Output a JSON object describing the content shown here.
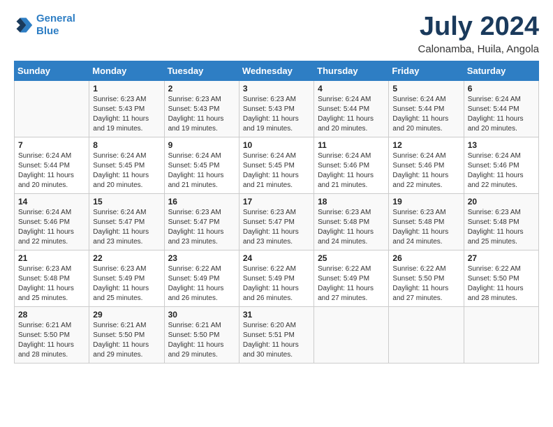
{
  "header": {
    "logo_line1": "General",
    "logo_line2": "Blue",
    "title": "July 2024",
    "location": "Calonamba, Huila, Angola"
  },
  "days_of_week": [
    "Sunday",
    "Monday",
    "Tuesday",
    "Wednesday",
    "Thursday",
    "Friday",
    "Saturday"
  ],
  "weeks": [
    [
      {
        "day": "",
        "info": ""
      },
      {
        "day": "1",
        "info": "Sunrise: 6:23 AM\nSunset: 5:43 PM\nDaylight: 11 hours\nand 19 minutes."
      },
      {
        "day": "2",
        "info": "Sunrise: 6:23 AM\nSunset: 5:43 PM\nDaylight: 11 hours\nand 19 minutes."
      },
      {
        "day": "3",
        "info": "Sunrise: 6:23 AM\nSunset: 5:43 PM\nDaylight: 11 hours\nand 19 minutes."
      },
      {
        "day": "4",
        "info": "Sunrise: 6:24 AM\nSunset: 5:44 PM\nDaylight: 11 hours\nand 20 minutes."
      },
      {
        "day": "5",
        "info": "Sunrise: 6:24 AM\nSunset: 5:44 PM\nDaylight: 11 hours\nand 20 minutes."
      },
      {
        "day": "6",
        "info": "Sunrise: 6:24 AM\nSunset: 5:44 PM\nDaylight: 11 hours\nand 20 minutes."
      }
    ],
    [
      {
        "day": "7",
        "info": "Sunrise: 6:24 AM\nSunset: 5:44 PM\nDaylight: 11 hours\nand 20 minutes."
      },
      {
        "day": "8",
        "info": "Sunrise: 6:24 AM\nSunset: 5:45 PM\nDaylight: 11 hours\nand 20 minutes."
      },
      {
        "day": "9",
        "info": "Sunrise: 6:24 AM\nSunset: 5:45 PM\nDaylight: 11 hours\nand 21 minutes."
      },
      {
        "day": "10",
        "info": "Sunrise: 6:24 AM\nSunset: 5:45 PM\nDaylight: 11 hours\nand 21 minutes."
      },
      {
        "day": "11",
        "info": "Sunrise: 6:24 AM\nSunset: 5:46 PM\nDaylight: 11 hours\nand 21 minutes."
      },
      {
        "day": "12",
        "info": "Sunrise: 6:24 AM\nSunset: 5:46 PM\nDaylight: 11 hours\nand 22 minutes."
      },
      {
        "day": "13",
        "info": "Sunrise: 6:24 AM\nSunset: 5:46 PM\nDaylight: 11 hours\nand 22 minutes."
      }
    ],
    [
      {
        "day": "14",
        "info": "Sunrise: 6:24 AM\nSunset: 5:46 PM\nDaylight: 11 hours\nand 22 minutes."
      },
      {
        "day": "15",
        "info": "Sunrise: 6:24 AM\nSunset: 5:47 PM\nDaylight: 11 hours\nand 23 minutes."
      },
      {
        "day": "16",
        "info": "Sunrise: 6:23 AM\nSunset: 5:47 PM\nDaylight: 11 hours\nand 23 minutes."
      },
      {
        "day": "17",
        "info": "Sunrise: 6:23 AM\nSunset: 5:47 PM\nDaylight: 11 hours\nand 23 minutes."
      },
      {
        "day": "18",
        "info": "Sunrise: 6:23 AM\nSunset: 5:48 PM\nDaylight: 11 hours\nand 24 minutes."
      },
      {
        "day": "19",
        "info": "Sunrise: 6:23 AM\nSunset: 5:48 PM\nDaylight: 11 hours\nand 24 minutes."
      },
      {
        "day": "20",
        "info": "Sunrise: 6:23 AM\nSunset: 5:48 PM\nDaylight: 11 hours\nand 25 minutes."
      }
    ],
    [
      {
        "day": "21",
        "info": "Sunrise: 6:23 AM\nSunset: 5:48 PM\nDaylight: 11 hours\nand 25 minutes."
      },
      {
        "day": "22",
        "info": "Sunrise: 6:23 AM\nSunset: 5:49 PM\nDaylight: 11 hours\nand 25 minutes."
      },
      {
        "day": "23",
        "info": "Sunrise: 6:22 AM\nSunset: 5:49 PM\nDaylight: 11 hours\nand 26 minutes."
      },
      {
        "day": "24",
        "info": "Sunrise: 6:22 AM\nSunset: 5:49 PM\nDaylight: 11 hours\nand 26 minutes."
      },
      {
        "day": "25",
        "info": "Sunrise: 6:22 AM\nSunset: 5:49 PM\nDaylight: 11 hours\nand 27 minutes."
      },
      {
        "day": "26",
        "info": "Sunrise: 6:22 AM\nSunset: 5:50 PM\nDaylight: 11 hours\nand 27 minutes."
      },
      {
        "day": "27",
        "info": "Sunrise: 6:22 AM\nSunset: 5:50 PM\nDaylight: 11 hours\nand 28 minutes."
      }
    ],
    [
      {
        "day": "28",
        "info": "Sunrise: 6:21 AM\nSunset: 5:50 PM\nDaylight: 11 hours\nand 28 minutes."
      },
      {
        "day": "29",
        "info": "Sunrise: 6:21 AM\nSunset: 5:50 PM\nDaylight: 11 hours\nand 29 minutes."
      },
      {
        "day": "30",
        "info": "Sunrise: 6:21 AM\nSunset: 5:50 PM\nDaylight: 11 hours\nand 29 minutes."
      },
      {
        "day": "31",
        "info": "Sunrise: 6:20 AM\nSunset: 5:51 PM\nDaylight: 11 hours\nand 30 minutes."
      },
      {
        "day": "",
        "info": ""
      },
      {
        "day": "",
        "info": ""
      },
      {
        "day": "",
        "info": ""
      }
    ]
  ]
}
